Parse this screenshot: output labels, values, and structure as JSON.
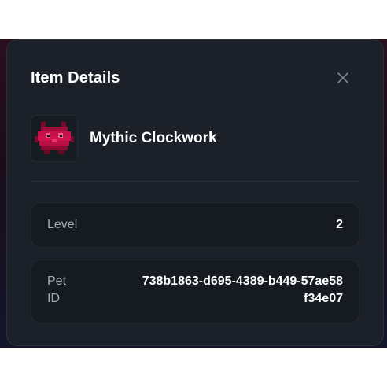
{
  "modal": {
    "title": "Item Details",
    "close_icon": "close-icon"
  },
  "item": {
    "name": "Mythic Clockwork",
    "icon": "pixel-pet-icon",
    "accent_color": "#d0124e"
  },
  "stats": {
    "level": {
      "label": "Level",
      "value": "2"
    },
    "pet_id": {
      "label": "Pet ID",
      "value": "738b1863-d695-4389-b449-57ae58f34e07"
    }
  }
}
